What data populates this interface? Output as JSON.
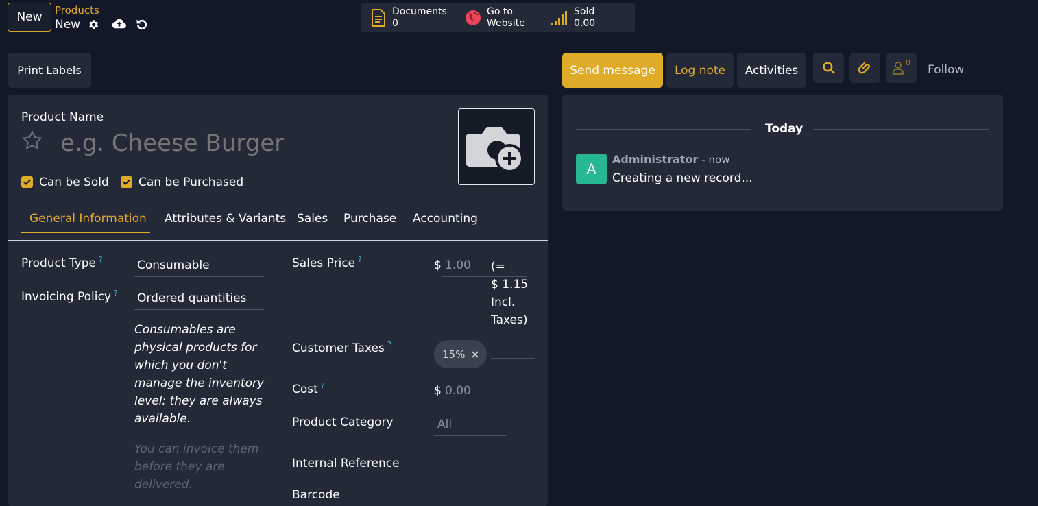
{
  "topbar": {
    "new_label": "New",
    "breadcrumb_parent": "Products",
    "breadcrumb_current": "New",
    "smart_buttons": {
      "documents_label": "Documents",
      "documents_count": "0",
      "website_line1": "Go to",
      "website_line2": "Website",
      "sold_label": "Sold",
      "sold_value": "0.00"
    }
  },
  "actions": {
    "print_labels": "Print Labels"
  },
  "chatter_buttons": {
    "send_message": "Send message",
    "log_note": "Log note",
    "activities": "Activities",
    "followers_count": "0",
    "follow": "Follow"
  },
  "form": {
    "product_name_label": "Product Name",
    "product_name_placeholder": "e.g. Cheese Burger",
    "can_be_sold": "Can be Sold",
    "can_be_purchased": "Can be Purchased",
    "tabs": [
      "General Information",
      "Attributes & Variants",
      "Sales",
      "Purchase",
      "Accounting"
    ],
    "left": {
      "product_type_label": "Product Type",
      "product_type_value": "Consumable",
      "invoicing_policy_label": "Invoicing Policy",
      "invoicing_policy_value": "Ordered quantities",
      "type_help": "Consumables are physical products for which you don't manage the inventory level: they are always available.",
      "invoice_help": "You can invoice them before they are delivered."
    },
    "right": {
      "sales_price_label": "Sales Price",
      "currency": "$",
      "sales_price_value": "1.00",
      "incl_line1": "(=",
      "incl_line2": "$ 1.15",
      "incl_line3": "Incl.",
      "incl_line4": "Taxes)",
      "customer_taxes_label": "Customer Taxes",
      "tax_tag": "15%",
      "cost_label": "Cost",
      "cost_value": "0.00",
      "category_label": "Product Category",
      "category_value": "All",
      "internal_ref_label": "Internal Reference",
      "barcode_label": "Barcode"
    }
  },
  "chatter": {
    "today": "Today",
    "avatar_letter": "A",
    "author": "Administrator",
    "time": "- now",
    "message": "Creating a new record..."
  },
  "colors": {
    "accent": "#e0ac28",
    "background": "#131829",
    "panel": "#232937",
    "avatar": "#27b893"
  },
  "icons": [
    "gear-icon",
    "cloud-upload-icon",
    "discard-icon",
    "document-icon",
    "globe-icon",
    "signal-bars-icon",
    "search-icon",
    "paperclip-icon",
    "user-icon",
    "star-icon",
    "camera-plus-icon",
    "close-icon",
    "check-icon"
  ]
}
